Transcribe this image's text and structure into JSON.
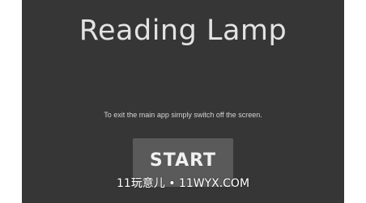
{
  "app": {
    "title": "Reading Lamp",
    "exit_hint": "To exit the main app simply switch off the screen.",
    "start_label": "START"
  },
  "watermark": {
    "text": "11玩意儿 • 11WYX.COM"
  },
  "colors": {
    "background": "#363636",
    "button": "#5a5a5a",
    "title_text": "#e3e3e3"
  }
}
